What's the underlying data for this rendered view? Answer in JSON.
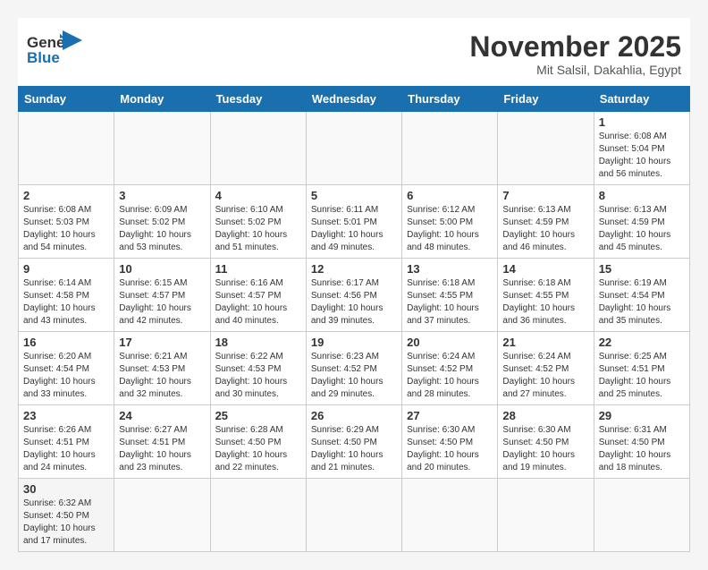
{
  "header": {
    "logo_line1": "General",
    "logo_line2": "Blue",
    "month": "November 2025",
    "location": "Mit Salsil, Dakahlia, Egypt"
  },
  "weekdays": [
    "Sunday",
    "Monday",
    "Tuesday",
    "Wednesday",
    "Thursday",
    "Friday",
    "Saturday"
  ],
  "weeks": [
    [
      {
        "day": "",
        "info": ""
      },
      {
        "day": "",
        "info": ""
      },
      {
        "day": "",
        "info": ""
      },
      {
        "day": "",
        "info": ""
      },
      {
        "day": "",
        "info": ""
      },
      {
        "day": "",
        "info": ""
      },
      {
        "day": "1",
        "info": "Sunrise: 6:08 AM\nSunset: 5:04 PM\nDaylight: 10 hours\nand 56 minutes."
      }
    ],
    [
      {
        "day": "2",
        "info": "Sunrise: 6:08 AM\nSunset: 5:03 PM\nDaylight: 10 hours\nand 54 minutes."
      },
      {
        "day": "3",
        "info": "Sunrise: 6:09 AM\nSunset: 5:02 PM\nDaylight: 10 hours\nand 53 minutes."
      },
      {
        "day": "4",
        "info": "Sunrise: 6:10 AM\nSunset: 5:02 PM\nDaylight: 10 hours\nand 51 minutes."
      },
      {
        "day": "5",
        "info": "Sunrise: 6:11 AM\nSunset: 5:01 PM\nDaylight: 10 hours\nand 49 minutes."
      },
      {
        "day": "6",
        "info": "Sunrise: 6:12 AM\nSunset: 5:00 PM\nDaylight: 10 hours\nand 48 minutes."
      },
      {
        "day": "7",
        "info": "Sunrise: 6:13 AM\nSunset: 4:59 PM\nDaylight: 10 hours\nand 46 minutes."
      },
      {
        "day": "8",
        "info": "Sunrise: 6:13 AM\nSunset: 4:59 PM\nDaylight: 10 hours\nand 45 minutes."
      }
    ],
    [
      {
        "day": "9",
        "info": "Sunrise: 6:14 AM\nSunset: 4:58 PM\nDaylight: 10 hours\nand 43 minutes."
      },
      {
        "day": "10",
        "info": "Sunrise: 6:15 AM\nSunset: 4:57 PM\nDaylight: 10 hours\nand 42 minutes."
      },
      {
        "day": "11",
        "info": "Sunrise: 6:16 AM\nSunset: 4:57 PM\nDaylight: 10 hours\nand 40 minutes."
      },
      {
        "day": "12",
        "info": "Sunrise: 6:17 AM\nSunset: 4:56 PM\nDaylight: 10 hours\nand 39 minutes."
      },
      {
        "day": "13",
        "info": "Sunrise: 6:18 AM\nSunset: 4:55 PM\nDaylight: 10 hours\nand 37 minutes."
      },
      {
        "day": "14",
        "info": "Sunrise: 6:18 AM\nSunset: 4:55 PM\nDaylight: 10 hours\nand 36 minutes."
      },
      {
        "day": "15",
        "info": "Sunrise: 6:19 AM\nSunset: 4:54 PM\nDaylight: 10 hours\nand 35 minutes."
      }
    ],
    [
      {
        "day": "16",
        "info": "Sunrise: 6:20 AM\nSunset: 4:54 PM\nDaylight: 10 hours\nand 33 minutes."
      },
      {
        "day": "17",
        "info": "Sunrise: 6:21 AM\nSunset: 4:53 PM\nDaylight: 10 hours\nand 32 minutes."
      },
      {
        "day": "18",
        "info": "Sunrise: 6:22 AM\nSunset: 4:53 PM\nDaylight: 10 hours\nand 30 minutes."
      },
      {
        "day": "19",
        "info": "Sunrise: 6:23 AM\nSunset: 4:52 PM\nDaylight: 10 hours\nand 29 minutes."
      },
      {
        "day": "20",
        "info": "Sunrise: 6:24 AM\nSunset: 4:52 PM\nDaylight: 10 hours\nand 28 minutes."
      },
      {
        "day": "21",
        "info": "Sunrise: 6:24 AM\nSunset: 4:52 PM\nDaylight: 10 hours\nand 27 minutes."
      },
      {
        "day": "22",
        "info": "Sunrise: 6:25 AM\nSunset: 4:51 PM\nDaylight: 10 hours\nand 25 minutes."
      }
    ],
    [
      {
        "day": "23",
        "info": "Sunrise: 6:26 AM\nSunset: 4:51 PM\nDaylight: 10 hours\nand 24 minutes."
      },
      {
        "day": "24",
        "info": "Sunrise: 6:27 AM\nSunset: 4:51 PM\nDaylight: 10 hours\nand 23 minutes."
      },
      {
        "day": "25",
        "info": "Sunrise: 6:28 AM\nSunset: 4:50 PM\nDaylight: 10 hours\nand 22 minutes."
      },
      {
        "day": "26",
        "info": "Sunrise: 6:29 AM\nSunset: 4:50 PM\nDaylight: 10 hours\nand 21 minutes."
      },
      {
        "day": "27",
        "info": "Sunrise: 6:30 AM\nSunset: 4:50 PM\nDaylight: 10 hours\nand 20 minutes."
      },
      {
        "day": "28",
        "info": "Sunrise: 6:30 AM\nSunset: 4:50 PM\nDaylight: 10 hours\nand 19 minutes."
      },
      {
        "day": "29",
        "info": "Sunrise: 6:31 AM\nSunset: 4:50 PM\nDaylight: 10 hours\nand 18 minutes."
      }
    ],
    [
      {
        "day": "30",
        "info": "Sunrise: 6:32 AM\nSunset: 4:50 PM\nDaylight: 10 hours\nand 17 minutes."
      },
      {
        "day": "",
        "info": ""
      },
      {
        "day": "",
        "info": ""
      },
      {
        "day": "",
        "info": ""
      },
      {
        "day": "",
        "info": ""
      },
      {
        "day": "",
        "info": ""
      },
      {
        "day": "",
        "info": ""
      }
    ]
  ]
}
